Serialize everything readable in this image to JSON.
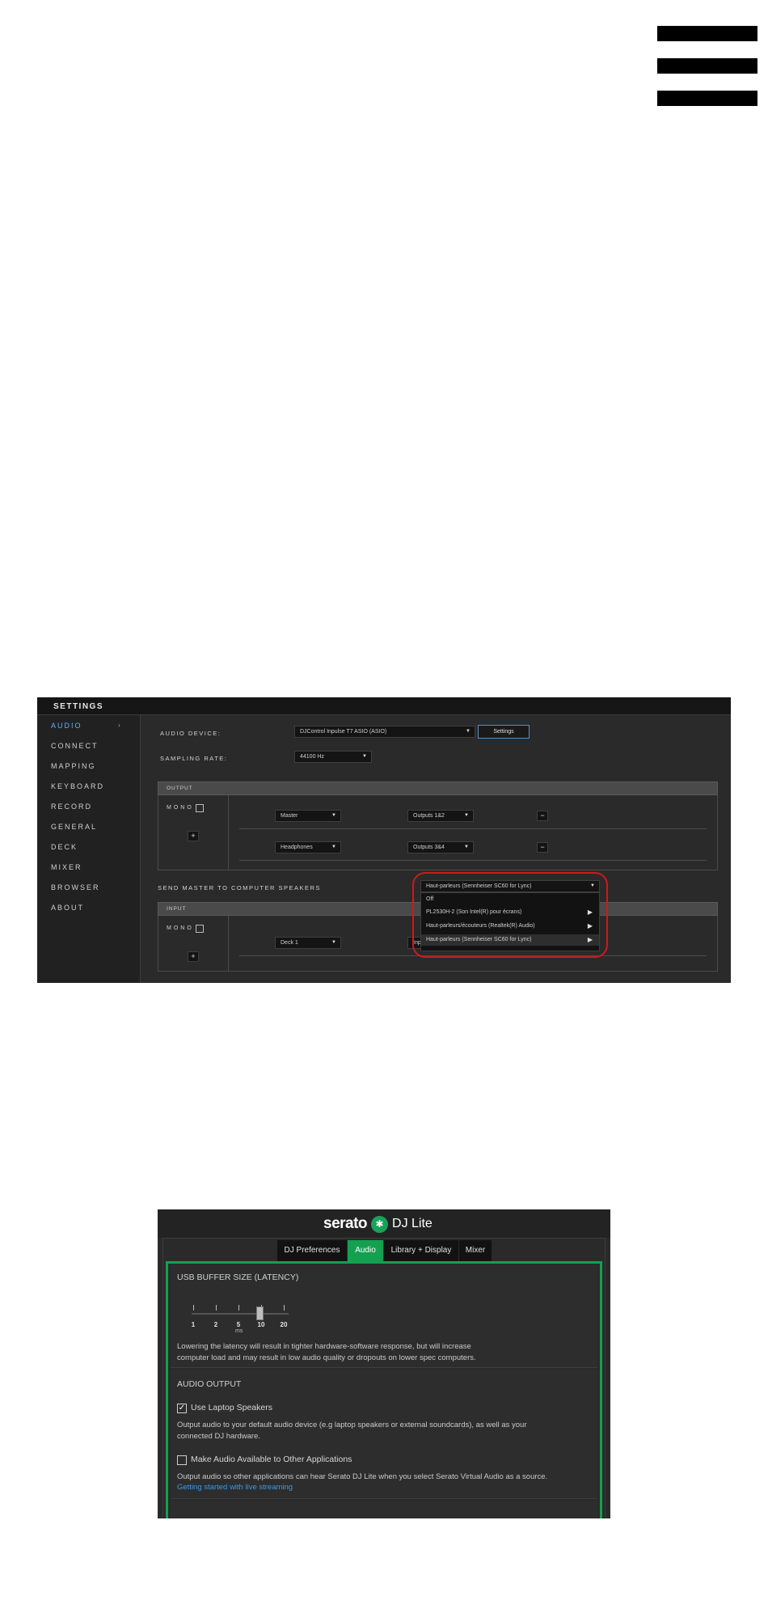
{
  "menu": {
    "icon": "hamburger-menu-icon"
  },
  "settings": {
    "title": "SETTINGS",
    "nav": [
      "AUDIO",
      "CONNECT",
      "MAPPING",
      "KEYBOARD",
      "RECORD",
      "GENERAL",
      "DECK",
      "MIXER",
      "BROWSER",
      "ABOUT"
    ],
    "nav_active": "AUDIO",
    "nav_arrow": "›",
    "audio_device_label": "AUDIO DEVICE:",
    "audio_device_value": "DJControl Inpulse T7 ASIO (ASIO)",
    "settings_button": "Settings",
    "sampling_rate_label": "SAMPLING RATE:",
    "sampling_rate_value": "44100 Hz",
    "output_header": "OUTPUT",
    "mono_label": "MONO",
    "add_button": "+",
    "remove_button": "−",
    "output_rows": [
      {
        "source": "Master",
        "dest": "Outputs 1&2"
      },
      {
        "source": "Headphones",
        "dest": "Outputs 3&4"
      }
    ],
    "send_master_label": "SEND MASTER TO COMPUTER SPEAKERS",
    "send_master_value": "Haut-parleurs (Sennheiser SC60 for Lync)",
    "send_master_options": [
      "Off",
      "PL2530H-2 (Son Intel(R) pour écrans)",
      "Haut-parleurs/écouteurs (Realtek(R) Audio)",
      "Haut-parleurs (Sennheiser SC60 for Lync)"
    ],
    "input_header": "INPUT",
    "input_rows": [
      {
        "source": "Deck 1",
        "dest": "Inp"
      }
    ],
    "highlight_color": "#d4161b",
    "active_color": "#5eb4ff"
  },
  "djlite": {
    "brand": "serato",
    "product": "DJ Lite",
    "logo_icon": "serato-logo-icon",
    "tabs": [
      "DJ Preferences",
      "Audio",
      "Library + Display",
      "Mixer"
    ],
    "active_tab": "Audio",
    "accent_color": "#14a050",
    "buffer_heading": "USB BUFFER SIZE (LATENCY)",
    "buffer_ticks": [
      "1",
      "2",
      "5",
      "10",
      "20"
    ],
    "buffer_unit": "ms",
    "buffer_value": "10",
    "buffer_note_1": "Lowering the latency will result in tighter hardware-software response, but will increase",
    "buffer_note_2": "computer load and may result in low audio quality or dropouts on lower spec computers.",
    "output_heading": "AUDIO OUTPUT",
    "laptop_speakers_label": "Use Laptop Speakers",
    "laptop_speakers_checked": true,
    "laptop_note_1": "Output audio to your default audio device (e.g laptop speakers or external soundcards), as well as your",
    "laptop_note_2": "connected DJ hardware.",
    "other_apps_label": "Make Audio Available to Other Applications",
    "other_apps_checked": false,
    "other_apps_note": "Output audio so other applications can hear Serato DJ Lite when you select Serato Virtual Audio as a source.",
    "streaming_link": "Getting started with live streaming"
  }
}
